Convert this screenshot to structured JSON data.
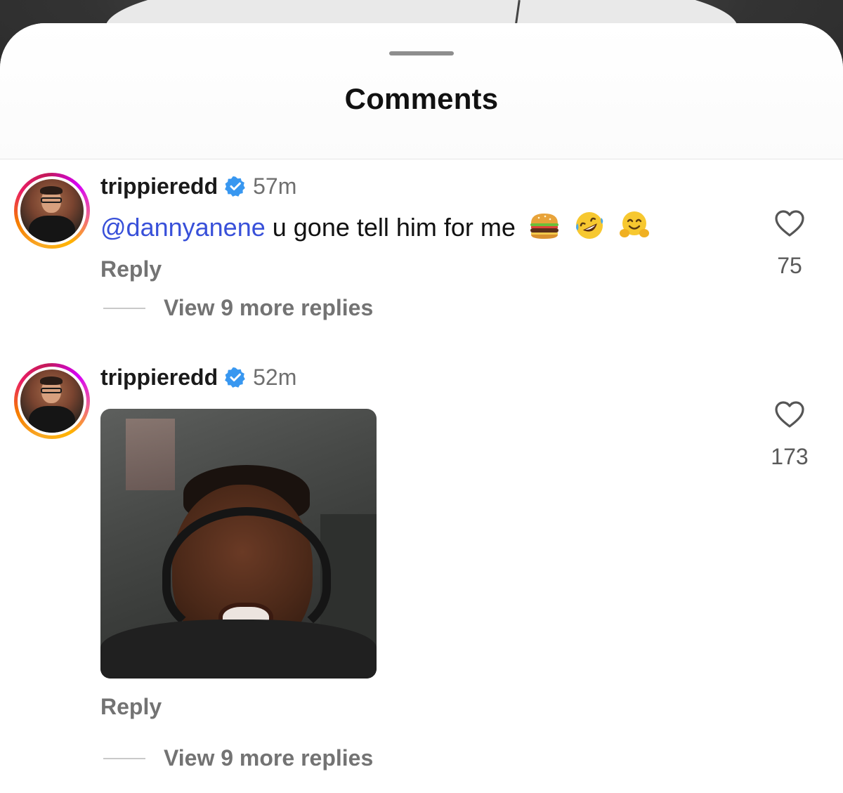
{
  "sheet": {
    "title": "Comments"
  },
  "comments": [
    {
      "username": "trippieredd",
      "time": "57m",
      "mention": "@dannyanene",
      "text": " u gone tell him for me",
      "emojis": [
        "hamburger",
        "rolling-on-floor-laughing",
        "hugging-face"
      ],
      "reply_label": "Reply",
      "like_count": "75",
      "view_replies_label": "View 9 more replies"
    },
    {
      "username": "trippieredd",
      "time": "52m",
      "media": "gif",
      "reply_label": "Reply",
      "like_count": "173",
      "view_replies_label": "View 9 more replies"
    }
  ],
  "colors": {
    "mention": "#3850d9",
    "verified": "#3897f0",
    "secondary_text": "#737373"
  }
}
